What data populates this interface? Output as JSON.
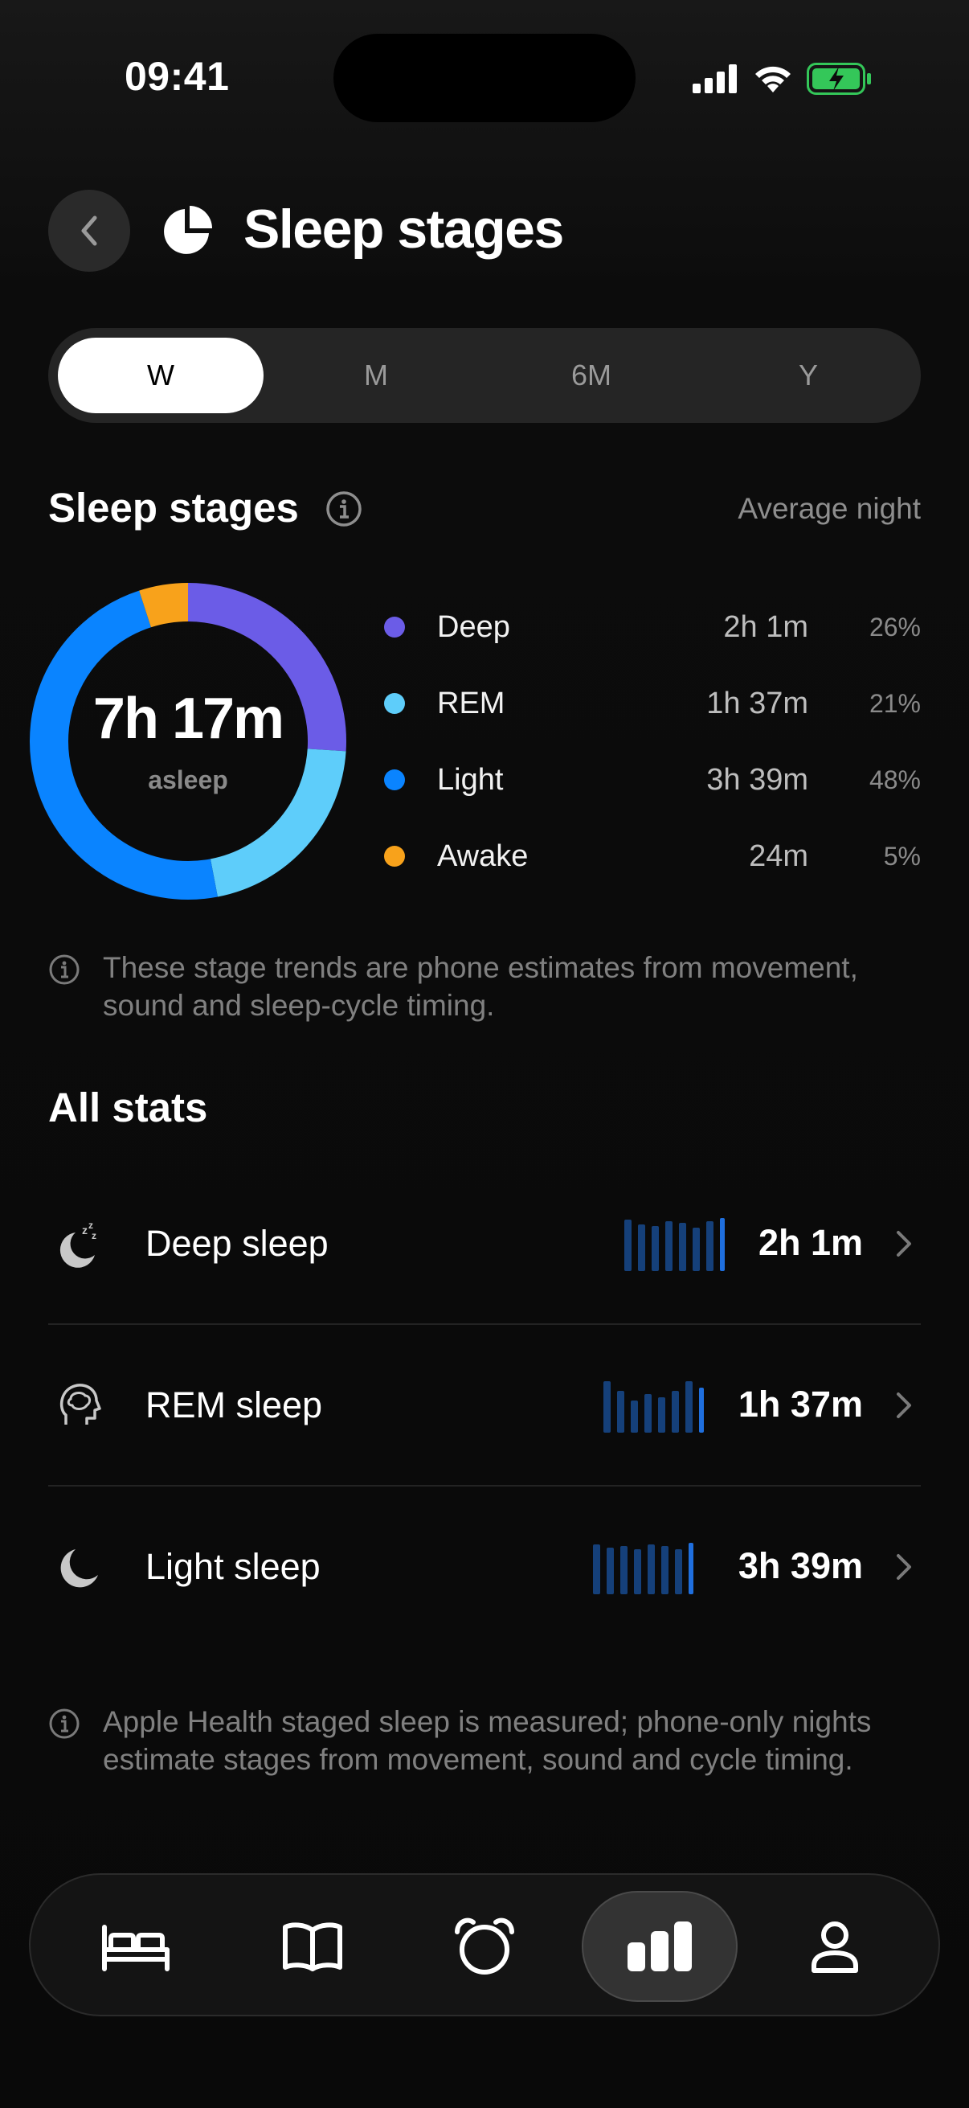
{
  "status_bar": {
    "time": "09:41"
  },
  "header": {
    "title": "Sleep stages"
  },
  "tabs": [
    {
      "label": "W",
      "active": true
    },
    {
      "label": "M",
      "active": false
    },
    {
      "label": "6M",
      "active": false
    },
    {
      "label": "Y",
      "active": false
    }
  ],
  "stages_section": {
    "title": "Sleep stages",
    "subtitle": "Average night",
    "donut": {
      "total": "7h 17m",
      "caption": "asleep"
    },
    "stages": [
      {
        "name": "Deep",
        "duration": "2h 1m",
        "percent": "26%",
        "fraction": 0.26,
        "color": "#6b5ce7"
      },
      {
        "name": "REM",
        "duration": "1h 37m",
        "percent": "21%",
        "fraction": 0.21,
        "color": "#5ecdfa"
      },
      {
        "name": "Light",
        "duration": "3h 39m",
        "percent": "48%",
        "fraction": 0.48,
        "color": "#0a84ff"
      },
      {
        "name": "Awake",
        "duration": "24m",
        "percent": "5%",
        "fraction": 0.05,
        "color": "#f8a21b"
      }
    ],
    "note": "These stage trends are phone estimates from movement, sound and sleep-cycle timing."
  },
  "all_stats": {
    "title": "All stats",
    "rows": [
      {
        "label": "Deep sleep",
        "value": "2h 1m",
        "icon": "moon-zzz-icon"
      },
      {
        "label": "REM sleep",
        "value": "1h 37m",
        "icon": "brain-head-icon"
      },
      {
        "label": "Light sleep",
        "value": "3h 39m",
        "icon": "moon-icon"
      }
    ],
    "note": "Apple Health staged sleep is measured; phone-only nights estimate stages from movement, sound and cycle timing."
  },
  "nav": [
    {
      "name": "bed-icon",
      "active": false
    },
    {
      "name": "book-icon",
      "active": false
    },
    {
      "name": "alarm-clock-icon",
      "active": false
    },
    {
      "name": "bar-chart-icon",
      "active": true
    },
    {
      "name": "profile-icon",
      "active": false
    }
  ],
  "colors": {
    "accent": "#0a84ff",
    "background": "#0c0c0c",
    "awake": "#f8a21b"
  }
}
